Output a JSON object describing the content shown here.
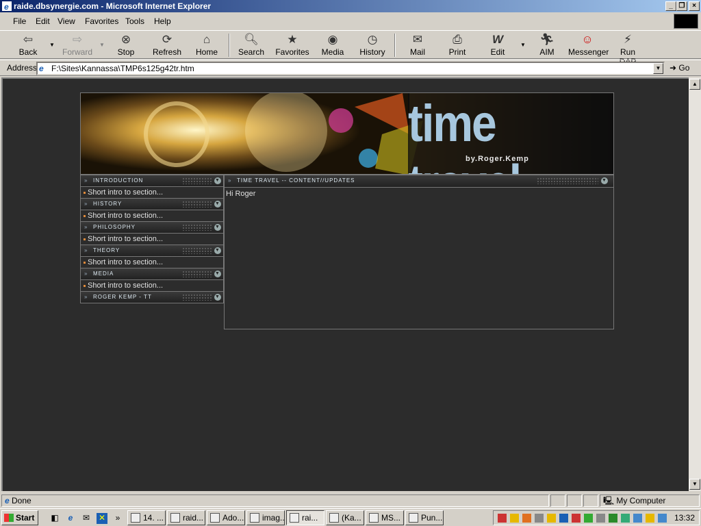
{
  "window": {
    "title": "raide.dbsynergie.com - Microsoft Internet Explorer"
  },
  "menu": [
    "File",
    "Edit",
    "View",
    "Favorites",
    "Tools",
    "Help"
  ],
  "toolbar": {
    "back": "Back",
    "forward": "Forward",
    "stop": "Stop",
    "refresh": "Refresh",
    "home": "Home",
    "search": "Search",
    "favorites": "Favorites",
    "media": "Media",
    "history": "History",
    "mail": "Mail",
    "print": "Print",
    "edit": "Edit",
    "aim": "AIM",
    "messenger": "Messenger",
    "rundap": "Run DAP"
  },
  "address": {
    "label": "Address",
    "url": "F:\\Sites\\Kannassa\\TMP6s125g42tr.htm",
    "go": "Go"
  },
  "page": {
    "banner_title": "time travel",
    "banner_byline": "by.Roger.Kemp",
    "nav": [
      {
        "header": "Introduction",
        "intro": "Short intro to section..."
      },
      {
        "header": "History",
        "intro": "Short intro to section..."
      },
      {
        "header": "Philosophy",
        "intro": "Short intro to section..."
      },
      {
        "header": "Theory",
        "intro": "Short intro to section..."
      },
      {
        "header": "Media",
        "intro": "Short intro to section..."
      },
      {
        "header": "Roger Kemp - TT"
      }
    ],
    "main_header": "Time Travel -- Content//Updates",
    "main_body": "Hi Roger"
  },
  "status": {
    "text": "Done",
    "zone": "My Computer"
  },
  "taskbar": {
    "start": "Start",
    "tasks": [
      "14. ...",
      "raid...",
      "Ado...",
      "imag...",
      "rai...",
      "(Ka...",
      "MS...",
      "Pun..."
    ],
    "clock": "13:32"
  },
  "colors": {
    "titlebar": "#0a246a",
    "page_bg": "#2c2c2c",
    "banner_text": "#a7c7de"
  }
}
